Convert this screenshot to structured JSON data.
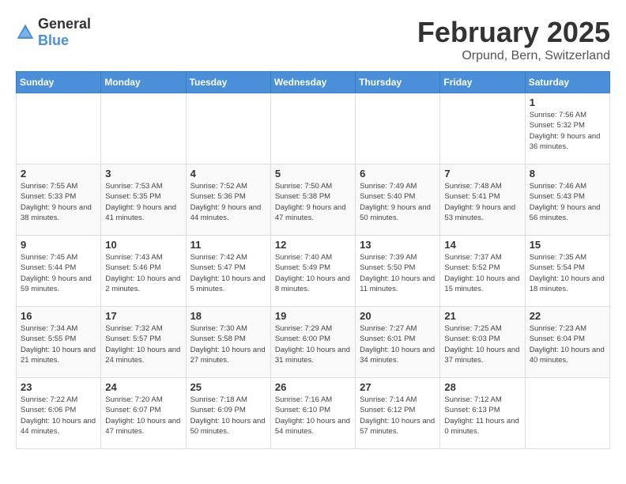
{
  "header": {
    "logo_general": "General",
    "logo_blue": "Blue",
    "title": "February 2025",
    "subtitle": "Orpund, Bern, Switzerland"
  },
  "days_of_week": [
    "Sunday",
    "Monday",
    "Tuesday",
    "Wednesday",
    "Thursday",
    "Friday",
    "Saturday"
  ],
  "weeks": [
    [
      {
        "day": "",
        "info": ""
      },
      {
        "day": "",
        "info": ""
      },
      {
        "day": "",
        "info": ""
      },
      {
        "day": "",
        "info": ""
      },
      {
        "day": "",
        "info": ""
      },
      {
        "day": "",
        "info": ""
      },
      {
        "day": "1",
        "info": "Sunrise: 7:56 AM\nSunset: 5:32 PM\nDaylight: 9 hours and 36 minutes."
      }
    ],
    [
      {
        "day": "2",
        "info": "Sunrise: 7:55 AM\nSunset: 5:33 PM\nDaylight: 9 hours and 38 minutes."
      },
      {
        "day": "3",
        "info": "Sunrise: 7:53 AM\nSunset: 5:35 PM\nDaylight: 9 hours and 41 minutes."
      },
      {
        "day": "4",
        "info": "Sunrise: 7:52 AM\nSunset: 5:36 PM\nDaylight: 9 hours and 44 minutes."
      },
      {
        "day": "5",
        "info": "Sunrise: 7:50 AM\nSunset: 5:38 PM\nDaylight: 9 hours and 47 minutes."
      },
      {
        "day": "6",
        "info": "Sunrise: 7:49 AM\nSunset: 5:40 PM\nDaylight: 9 hours and 50 minutes."
      },
      {
        "day": "7",
        "info": "Sunrise: 7:48 AM\nSunset: 5:41 PM\nDaylight: 9 hours and 53 minutes."
      },
      {
        "day": "8",
        "info": "Sunrise: 7:46 AM\nSunset: 5:43 PM\nDaylight: 9 hours and 56 minutes."
      }
    ],
    [
      {
        "day": "9",
        "info": "Sunrise: 7:45 AM\nSunset: 5:44 PM\nDaylight: 9 hours and 59 minutes."
      },
      {
        "day": "10",
        "info": "Sunrise: 7:43 AM\nSunset: 5:46 PM\nDaylight: 10 hours and 2 minutes."
      },
      {
        "day": "11",
        "info": "Sunrise: 7:42 AM\nSunset: 5:47 PM\nDaylight: 10 hours and 5 minutes."
      },
      {
        "day": "12",
        "info": "Sunrise: 7:40 AM\nSunset: 5:49 PM\nDaylight: 10 hours and 8 minutes."
      },
      {
        "day": "13",
        "info": "Sunrise: 7:39 AM\nSunset: 5:50 PM\nDaylight: 10 hours and 11 minutes."
      },
      {
        "day": "14",
        "info": "Sunrise: 7:37 AM\nSunset: 5:52 PM\nDaylight: 10 hours and 15 minutes."
      },
      {
        "day": "15",
        "info": "Sunrise: 7:35 AM\nSunset: 5:54 PM\nDaylight: 10 hours and 18 minutes."
      }
    ],
    [
      {
        "day": "16",
        "info": "Sunrise: 7:34 AM\nSunset: 5:55 PM\nDaylight: 10 hours and 21 minutes."
      },
      {
        "day": "17",
        "info": "Sunrise: 7:32 AM\nSunset: 5:57 PM\nDaylight: 10 hours and 24 minutes."
      },
      {
        "day": "18",
        "info": "Sunrise: 7:30 AM\nSunset: 5:58 PM\nDaylight: 10 hours and 27 minutes."
      },
      {
        "day": "19",
        "info": "Sunrise: 7:29 AM\nSunset: 6:00 PM\nDaylight: 10 hours and 31 minutes."
      },
      {
        "day": "20",
        "info": "Sunrise: 7:27 AM\nSunset: 6:01 PM\nDaylight: 10 hours and 34 minutes."
      },
      {
        "day": "21",
        "info": "Sunrise: 7:25 AM\nSunset: 6:03 PM\nDaylight: 10 hours and 37 minutes."
      },
      {
        "day": "22",
        "info": "Sunrise: 7:23 AM\nSunset: 6:04 PM\nDaylight: 10 hours and 40 minutes."
      }
    ],
    [
      {
        "day": "23",
        "info": "Sunrise: 7:22 AM\nSunset: 6:06 PM\nDaylight: 10 hours and 44 minutes."
      },
      {
        "day": "24",
        "info": "Sunrise: 7:20 AM\nSunset: 6:07 PM\nDaylight: 10 hours and 47 minutes."
      },
      {
        "day": "25",
        "info": "Sunrise: 7:18 AM\nSunset: 6:09 PM\nDaylight: 10 hours and 50 minutes."
      },
      {
        "day": "26",
        "info": "Sunrise: 7:16 AM\nSunset: 6:10 PM\nDaylight: 10 hours and 54 minutes."
      },
      {
        "day": "27",
        "info": "Sunrise: 7:14 AM\nSunset: 6:12 PM\nDaylight: 10 hours and 57 minutes."
      },
      {
        "day": "28",
        "info": "Sunrise: 7:12 AM\nSunset: 6:13 PM\nDaylight: 11 hours and 0 minutes."
      },
      {
        "day": "",
        "info": ""
      }
    ]
  ]
}
